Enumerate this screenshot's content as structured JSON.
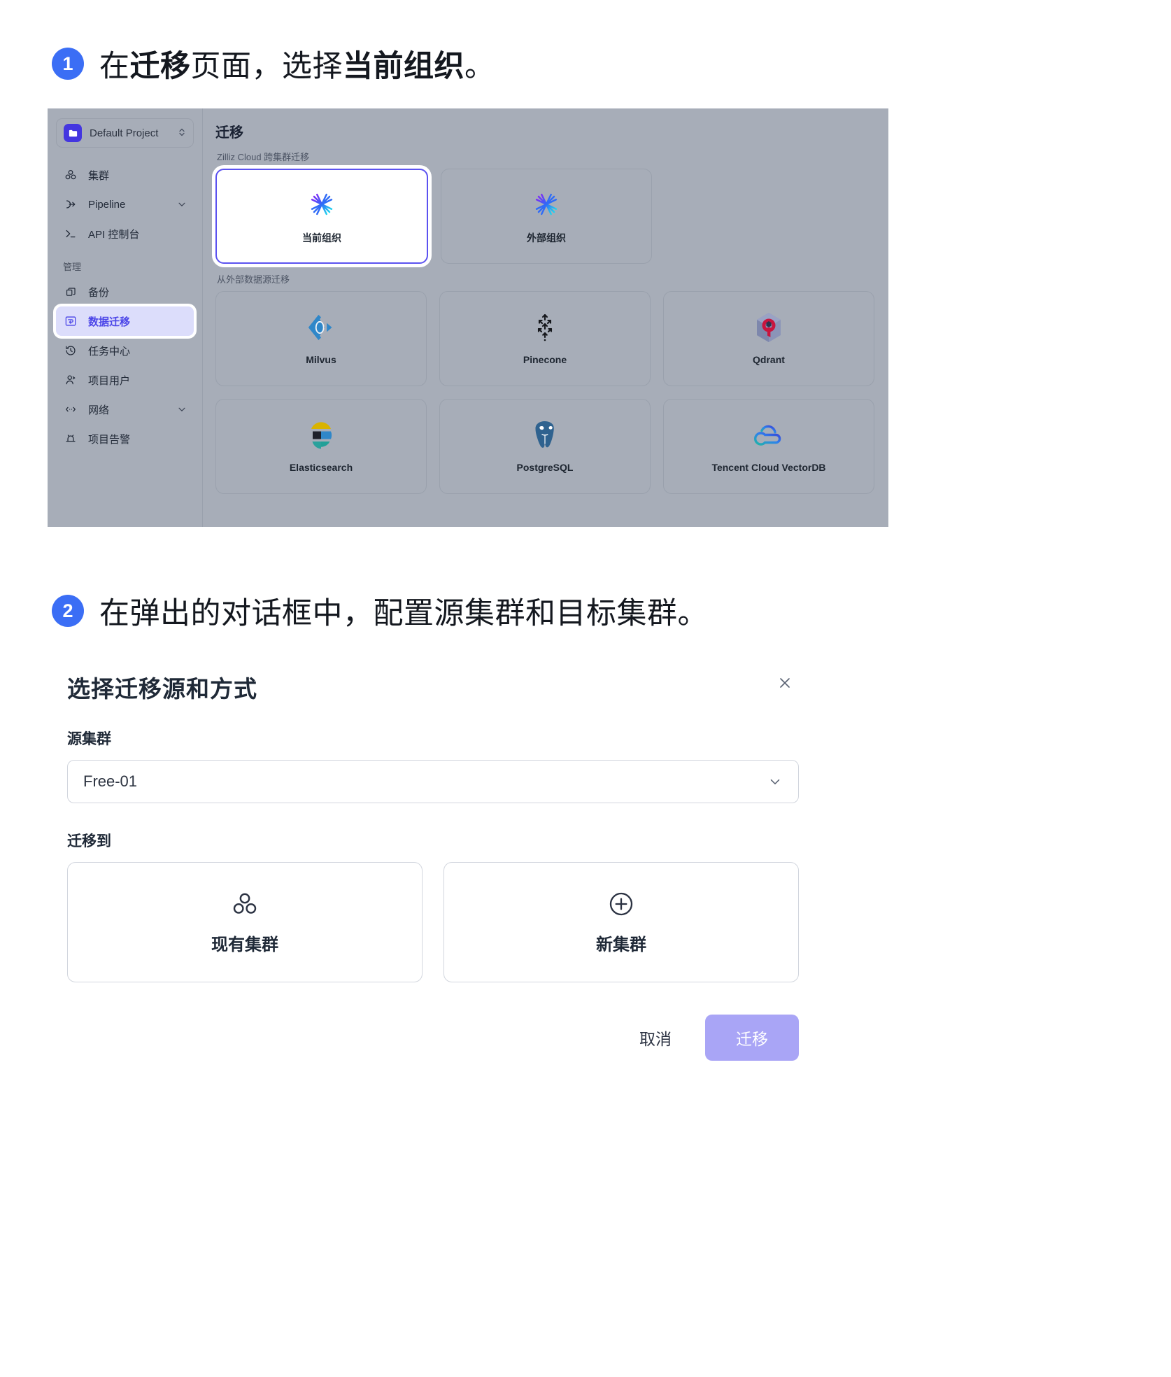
{
  "steps": [
    {
      "number": "1",
      "parts": [
        {
          "text": "在",
          "bold": false
        },
        {
          "text": "迁移",
          "bold": true
        },
        {
          "text": "页面，选择",
          "bold": false
        },
        {
          "text": "当前组织",
          "bold": true
        },
        {
          "text": "。",
          "bold": false
        }
      ],
      "plain": "在迁移页面，选择当前组织。"
    },
    {
      "number": "2",
      "plain": "在弹出的对话框中，配置源集群和目标集群。"
    }
  ],
  "console": {
    "sidebar": {
      "project": {
        "name": "Default Project",
        "icon": "folder-icon",
        "caret": "chevron-updown-icon"
      },
      "items": [
        {
          "label": "集群",
          "icon": "cluster-icon",
          "active": false,
          "expandable": false
        },
        {
          "label": "Pipeline",
          "icon": "pipeline-icon",
          "active": false,
          "expandable": true
        },
        {
          "label": "API 控制台",
          "icon": "terminal-icon",
          "active": false,
          "expandable": false
        }
      ],
      "section_label": "管理",
      "manage_items": [
        {
          "label": "备份",
          "icon": "backup-icon",
          "active": false,
          "expandable": false
        },
        {
          "label": "数据迁移",
          "icon": "migration-icon",
          "active": true,
          "expandable": false
        },
        {
          "label": "任务中心",
          "icon": "history-icon",
          "active": false,
          "expandable": false
        },
        {
          "label": "项目用户",
          "icon": "user-icon",
          "active": false,
          "expandable": false
        },
        {
          "label": "网络",
          "icon": "network-icon",
          "active": false,
          "expandable": true
        },
        {
          "label": "项目告警",
          "icon": "alert-icon",
          "active": false,
          "expandable": false
        }
      ]
    },
    "main": {
      "title": "迁移",
      "section_cross_cluster": "Zilliz Cloud 跨集群迁移",
      "org_cards": [
        {
          "label": "当前组织",
          "icon": "zilliz-star-icon",
          "selected": true
        },
        {
          "label": "外部组织",
          "icon": "zilliz-star-icon",
          "selected": false
        }
      ],
      "section_external": "从外部数据源迁移",
      "external_cards": [
        {
          "label": "Milvus",
          "icon": "milvus-icon"
        },
        {
          "label": "Pinecone",
          "icon": "pinecone-icon"
        },
        {
          "label": "Qdrant",
          "icon": "qdrant-icon"
        },
        {
          "label": "Elasticsearch",
          "icon": "elasticsearch-icon"
        },
        {
          "label": "PostgreSQL",
          "icon": "postgresql-icon"
        },
        {
          "label": "Tencent Cloud VectorDB",
          "icon": "tencent-cloud-icon"
        }
      ]
    }
  },
  "dialog": {
    "title": "选择迁移源和方式",
    "close_icon": "close-icon",
    "source_label": "源集群",
    "source_value": "Free-01",
    "source_caret": "chevron-down-icon",
    "destination_label": "迁移到",
    "destination_options": [
      {
        "label": "现有集群",
        "icon": "cluster-icon"
      },
      {
        "label": "新集群",
        "icon": "plus-circle-icon"
      }
    ],
    "cancel_label": "取消",
    "confirm_label": "迁移"
  },
  "colors": {
    "accent_blue": "#3b6ef5",
    "active_nav_bg": "#dcddfb",
    "active_nav_text": "#4c46e8",
    "selected_card_border": "#5b52f0",
    "panel_bg": "#a7adb8",
    "primary_button_bg": "#a9a5f6"
  }
}
